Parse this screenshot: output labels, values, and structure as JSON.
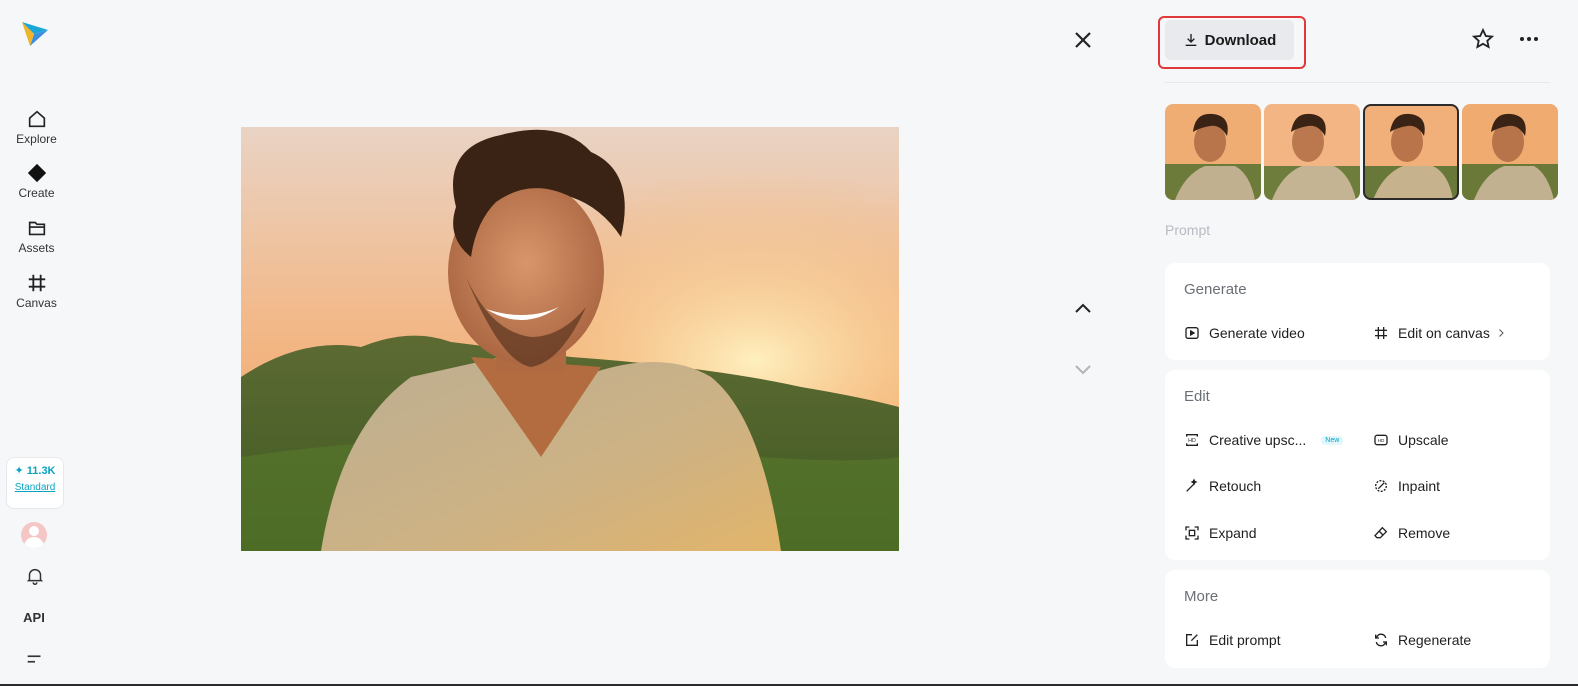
{
  "sidebar": {
    "logo": "paper-plane-logo",
    "nav": [
      {
        "label": "Explore",
        "icon": "home-icon"
      },
      {
        "label": "Create",
        "icon": "diamond-icon"
      },
      {
        "label": "Assets",
        "icon": "folder-icon"
      },
      {
        "label": "Canvas",
        "icon": "canvas-icon"
      }
    ],
    "credits": {
      "amount": "✦ 11.3K",
      "plan": "Standard"
    },
    "api_label": "API"
  },
  "viewer": {
    "close_icon": "close-icon",
    "prev_icon": "chevron-up-icon",
    "next_icon": "chevron-down-icon"
  },
  "panel": {
    "download_label": "Download",
    "thumbnails_count": 4,
    "selected_thumbnail": 3,
    "prompt_label": "Prompt",
    "generate": {
      "title": "Generate",
      "actions": [
        "Generate video",
        "Edit on canvas"
      ]
    },
    "edit": {
      "title": "Edit",
      "actions": [
        "Creative upsc...",
        "Upscale",
        "Retouch",
        "Inpaint",
        "Expand",
        "Remove"
      ],
      "new_badge": "New"
    },
    "more": {
      "title": "More",
      "actions": [
        "Edit prompt",
        "Regenerate"
      ]
    }
  },
  "colors": {
    "accent": "#0aa3c2",
    "highlight": "#e0383b",
    "background": "#f6f7f9"
  }
}
